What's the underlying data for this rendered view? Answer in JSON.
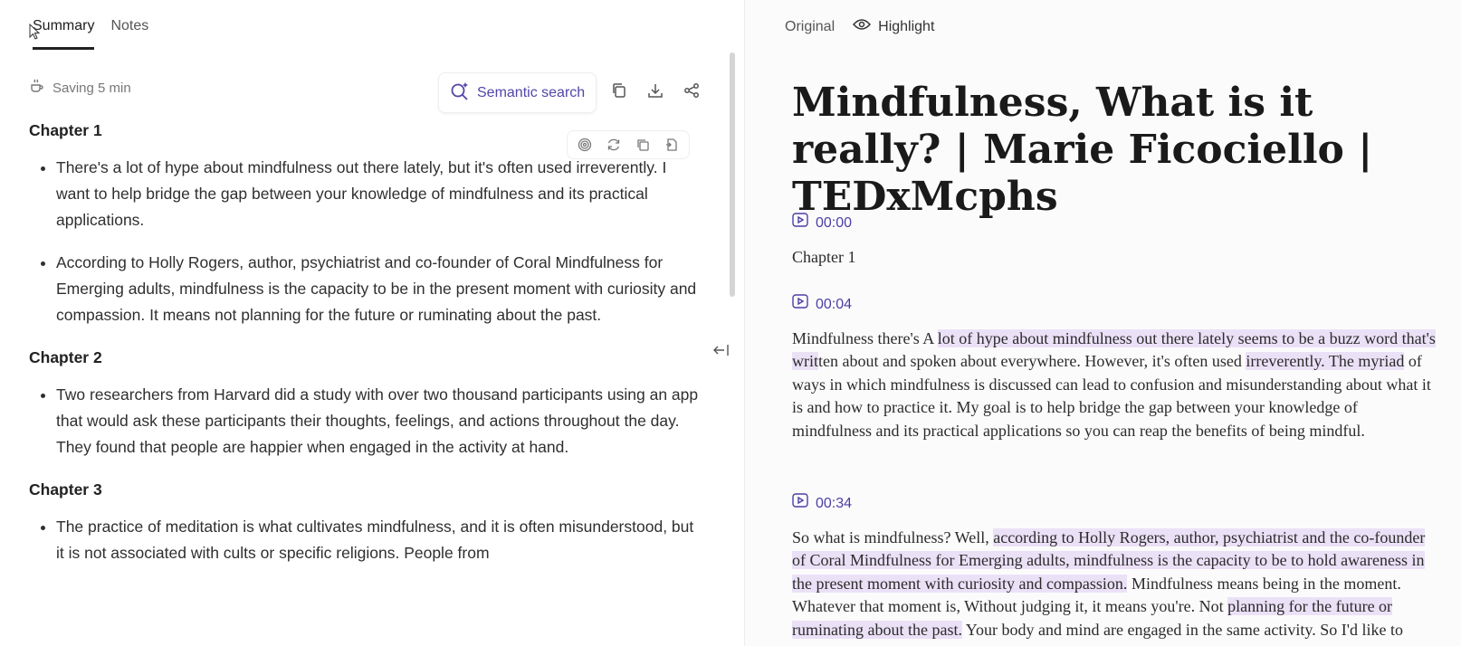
{
  "left": {
    "tabs": [
      {
        "label": "Summary",
        "active": true
      },
      {
        "label": "Notes",
        "active": false
      }
    ],
    "saving_label": "Saving 5 min",
    "semantic_search_label": "Semantic search",
    "chapters": [
      {
        "title": "Chapter 1",
        "bullets": [
          "There's a lot of hype about mindfulness out there lately, but it's often used irreverently. I want to help bridge the gap between your knowledge of mindfulness and its practical applications.",
          "According to Holly Rogers, author, psychiatrist and co-founder of Coral Mindfulness for Emerging adults, mindfulness is the capacity to be in the present moment with curiosity and compassion. It means not planning for the future or ruminating about the past."
        ]
      },
      {
        "title": "Chapter 2",
        "bullets": [
          "Two researchers from Harvard did a study with over two thousand participants using an app that would ask these participants their thoughts, feelings, and actions throughout the day. They found that people are happier when engaged in the activity at hand."
        ]
      },
      {
        "title": "Chapter 3",
        "bullets": [
          "The practice of meditation is what cultivates mindfulness, and it is often misunderstood, but it is not associated with cults or specific religions. People from"
        ]
      }
    ]
  },
  "right": {
    "tabs": {
      "original": "Original",
      "highlight": "Highlight"
    },
    "title": "Mindfulness, What is it really? | Marie Ficociello | TEDxMcphs",
    "segments": [
      {
        "ts": "00:00",
        "parts": [
          {
            "t": "Chapter 1",
            "h": false
          }
        ]
      },
      {
        "ts": "00:04",
        "parts": [
          {
            "t": "Mindfulness there's A ",
            "h": false
          },
          {
            "t": "lot of hype about mindfulness out there lately seems to be a buzz word that's writ",
            "h": true
          },
          {
            "t": "ten about and spoken about everywhere. However, it's often used ",
            "h": false
          },
          {
            "t": "irreverently. The myriad",
            "h": true
          },
          {
            "t": " of ways in which mindfulness is discussed can lead to confusion and misunderstanding about what it is and how to practice it. My goal is to help bridge the gap between your knowledge of mindfulness and its practical applications so you can reap the benefits of being mindful.",
            "h": false
          }
        ]
      },
      {
        "ts": "00:34",
        "parts": [
          {
            "t": "So what is mindfulness? Well, ",
            "h": false
          },
          {
            "t": "according to Holly Rogers, author, psychiatrist and the co-founder of Coral Mindfulness for Emerging adults, mindfulness is the capacity to be to hold awareness in the present moment with curiosity and compassion.",
            "h": true
          },
          {
            "t": " Mindfulness means being in the moment. Whatever that moment is, Without judging it, it means you're. Not ",
            "h": false
          },
          {
            "t": "planning for the future or ruminating about the past.",
            "h": true
          },
          {
            "t": " Your body and mind are engaged in the same activity. So I'd like to share a story with you, I think you'll enjoy it.",
            "h": false
          }
        ]
      }
    ]
  },
  "icons": [
    "coffee-icon",
    "semantic-search-icon",
    "copy-icon",
    "download-icon",
    "share-icon",
    "target-icon",
    "refresh-icon",
    "duplicate-icon",
    "export-icon",
    "collapse-panel-icon",
    "eye-icon",
    "play-timestamp-icon",
    "cursor-icon"
  ]
}
